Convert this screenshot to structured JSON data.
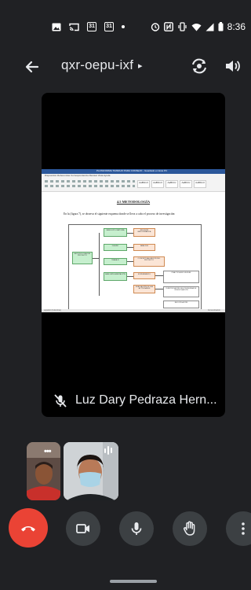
{
  "status_bar": {
    "time": "8:36",
    "calendar_a": "31",
    "calendar_b": "31",
    "icons": [
      "image-icon",
      "cast-icon",
      "calendar-icon",
      "calendar-icon",
      "dot-icon",
      "alarm-icon",
      "nfc-icon",
      "vibrate-icon",
      "wifi-icon",
      "signal-icon",
      "battery-icon"
    ]
  },
  "top_bar": {
    "meeting_code": "qxr-oepu-ixf",
    "caret": "▸",
    "icons": [
      "back-arrow-icon",
      "flip-camera-icon",
      "speaker-icon"
    ]
  },
  "main_tile": {
    "participant_name": "Luz Dary Pedraza Hern...",
    "mic_state": "muted",
    "shared_document": {
      "window_title": "PLATAFORMA TRABAJO PARA CONSEJO - Guardado en Este PC",
      "ribbon_tabs": "Disposición   Referencias   Correspondencia   Revisar   Vista   Ayuda",
      "style_samples": [
        "AaBbCcI",
        "AaBbCcI",
        "AaBbCc",
        "AaBbCc",
        "AaBbCcI"
      ],
      "heading": "4.5 METODOLOGÍA",
      "paragraph": "En la (figura 7), se observa el siguiente esquema donde se lleva a cabo el proceso de investigación:",
      "status_left": "español (Colombia)",
      "status_right": "Concentración",
      "diagram_boxes": {
        "root": "METODOLOGÍA DEL PROYECTO",
        "green": [
          "FASE EXPLORATORIA",
          "DISEÑO",
          "TRABAJO",
          "FASE IMPLEMENTACIÓN"
        ],
        "orange": [
          "REVISIÓN BIBLIOGRÁFICA",
          "ANÁLISIS",
          "CONCEPTUALIZACIÓN DEL PROYECTO",
          "EXPERIMENTO",
          "EVALUACIÓN DE LAS ACTIVIDADES"
        ],
        "white": [
          "PRÁCTICA ENCUESTAS",
          "IDENTIFICACIÓN DEL PROBLEMA DE INVESTIGACIÓN",
          "RECOPILACIÓN",
          "PROTOTIPO DE APP",
          "APLICACIÓN DE CONCEPTOS",
          "VALIDACIÓN"
        ]
      }
    }
  },
  "thumbnails": {
    "self_menu": "•••",
    "speaking_indicator": "audio-bars"
  },
  "controls": {
    "buttons": [
      "end-call",
      "camera",
      "microphone",
      "raise-hand",
      "more-options"
    ]
  },
  "colors": {
    "background": "#202124",
    "end_call": "#ea4335",
    "control_bg": "#3c4043",
    "word_blue": "#2b579a"
  }
}
